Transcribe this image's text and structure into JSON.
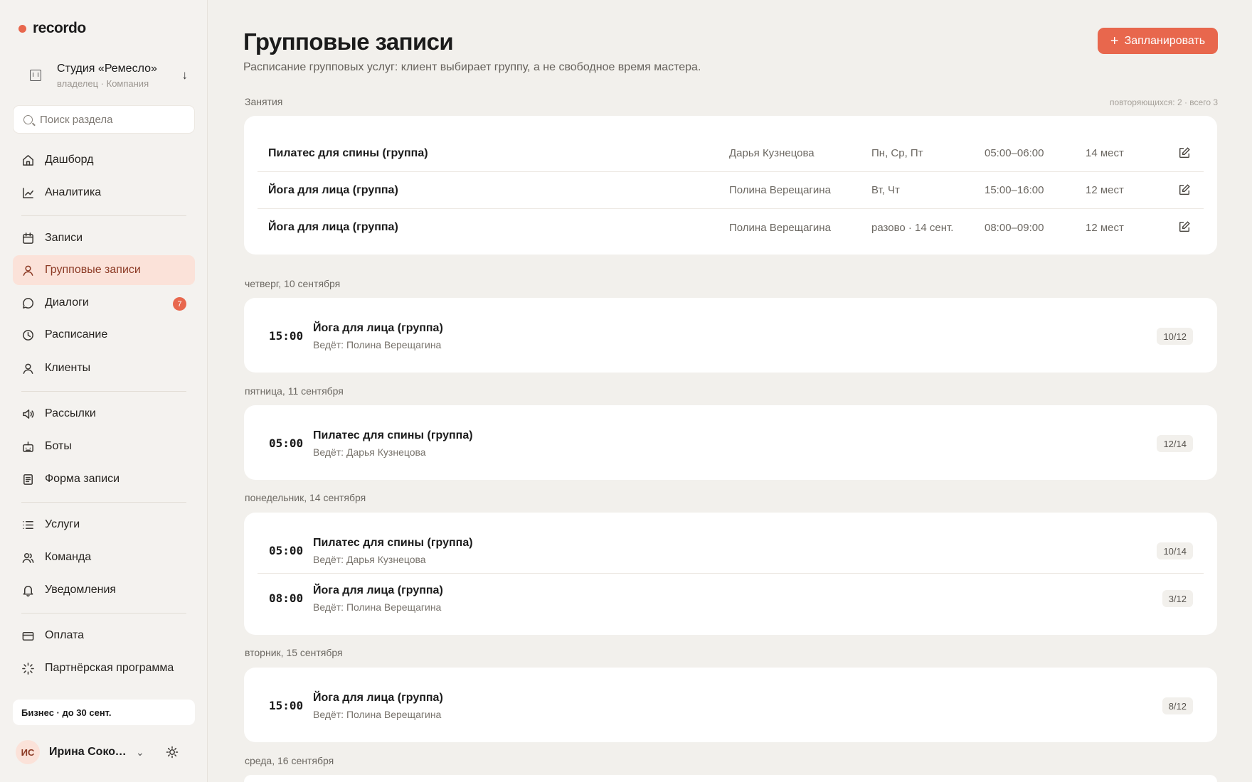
{
  "app": {
    "logo_text": "recordo",
    "brand_color": "#e8674d"
  },
  "company": {
    "name": "Студия «Ремесло»",
    "role": "владелец · Компания"
  },
  "search": {
    "placeholder": "Поиск раздела"
  },
  "nav": {
    "dashboard": "Дашборд",
    "analytics": "Аналитика",
    "bookings": "Записи",
    "group_bookings": "Групповые записи",
    "dialogs": "Диалоги",
    "dialogs_badge": "7",
    "schedule": "Расписание",
    "clients": "Клиенты",
    "mailings": "Рассылки",
    "bots": "Боты",
    "booking_form": "Форма записи",
    "services": "Услуги",
    "team": "Команда",
    "notifications": "Уведомления",
    "payment": "Оплата",
    "partner": "Партнёрская программа"
  },
  "plan": {
    "label": "Бизнес · до 30 сент."
  },
  "user": {
    "initials": "ИС",
    "name": "Ирина Сокол..."
  },
  "page": {
    "title": "Групповые записи",
    "subtitle": "Расписание групповых услуг: клиент выбирает группу, а не свободное время мастера.",
    "schedule_button": "Запланировать"
  },
  "classes": {
    "label": "Занятия",
    "meta": "повторяющихся: 2 · всего 3",
    "rows": [
      {
        "name": "Пилатес для спины (группа)",
        "master": "Дарья Кузнецова",
        "days": "Пн, Ср, Пт",
        "time": "05:00–06:00",
        "places": "14 мест"
      },
      {
        "name": "Йога для лица (группа)",
        "master": "Полина Верещагина",
        "days": "Вт, Чт",
        "time": "15:00–16:00",
        "places": "12 мест"
      },
      {
        "name": "Йога для лица (группа)",
        "master": "Полина Верещагина",
        "days": "разово · 14 сент.",
        "time": "08:00–09:00",
        "places": "12 мест"
      }
    ]
  },
  "days": [
    {
      "label": "четверг, 10 сентября",
      "sessions": [
        {
          "time": "15:00",
          "name": "Йога для лица (группа)",
          "lead": "Ведёт: Полина Верещагина",
          "capacity": "10/12"
        }
      ]
    },
    {
      "label": "пятница, 11 сентября",
      "sessions": [
        {
          "time": "05:00",
          "name": "Пилатес для спины (группа)",
          "lead": "Ведёт: Дарья Кузнецова",
          "capacity": "12/14"
        }
      ]
    },
    {
      "label": "понедельник, 14 сентября",
      "sessions": [
        {
          "time": "05:00",
          "name": "Пилатес для спины (группа)",
          "lead": "Ведёт: Дарья Кузнецова",
          "capacity": "10/14"
        },
        {
          "time": "08:00",
          "name": "Йога для лица (группа)",
          "lead": "Ведёт: Полина Верещагина",
          "capacity": "3/12"
        }
      ]
    },
    {
      "label": "вторник, 15 сентября",
      "sessions": [
        {
          "time": "15:00",
          "name": "Йога для лица (группа)",
          "lead": "Ведёт: Полина Верещагина",
          "capacity": "8/12"
        }
      ]
    },
    {
      "label": "среда, 16 сентября",
      "sessions": []
    }
  ]
}
